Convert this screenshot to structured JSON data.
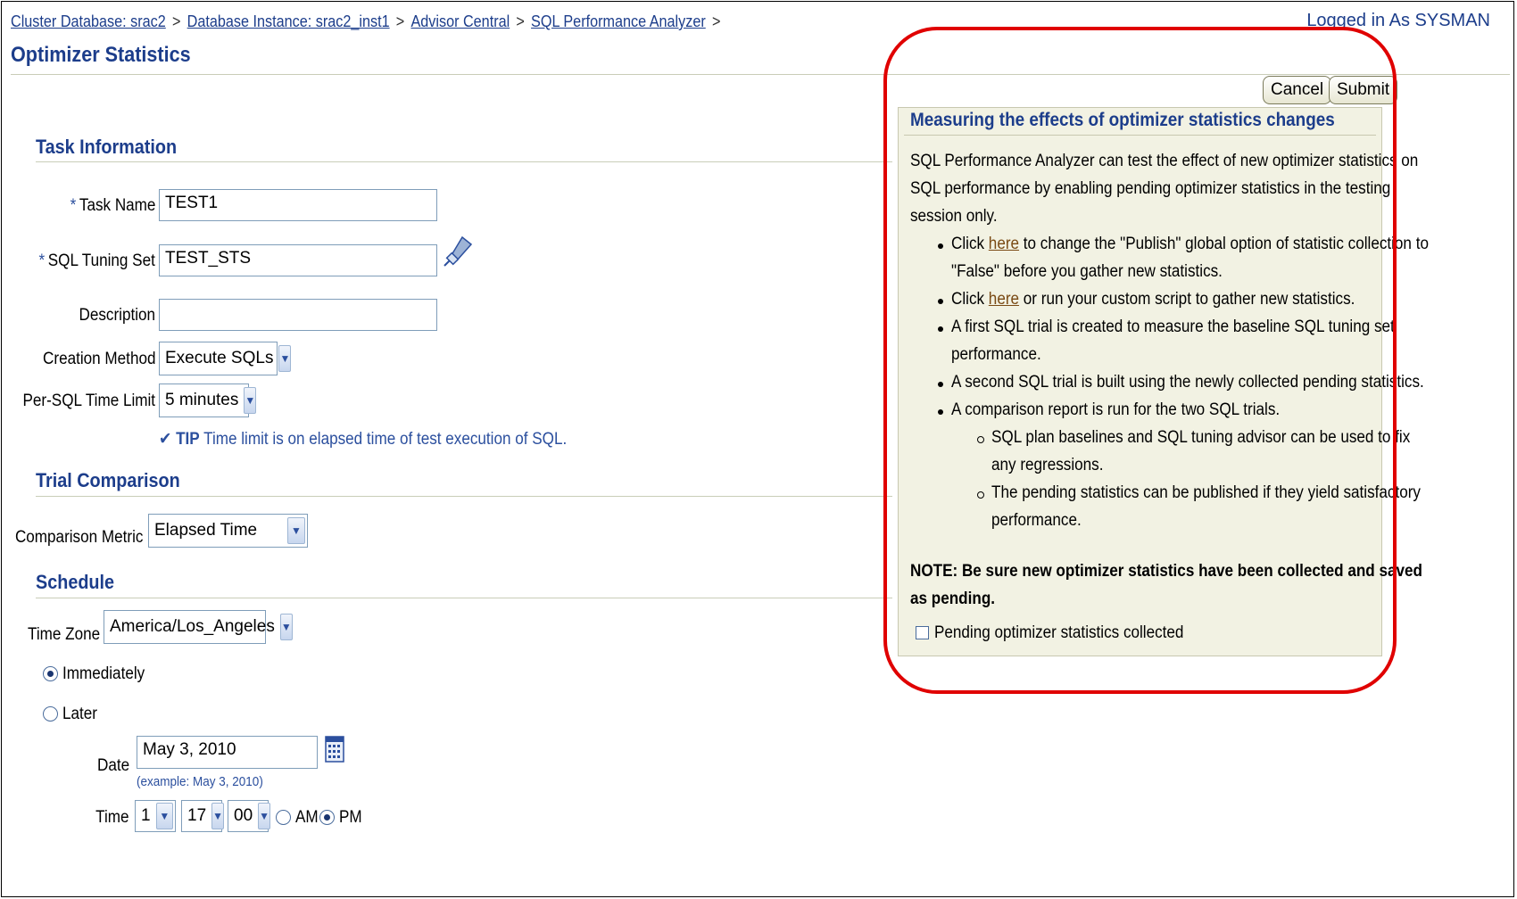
{
  "breadcrumb": [
    "Cluster Database: srac2",
    "Database Instance: srac2_inst1",
    "Advisor Central",
    "SQL Performance Analyzer"
  ],
  "breadcrumb_sep": ">",
  "login_text": "Logged in As SYSMAN",
  "page_title": "Optimizer Statistics",
  "buttons": {
    "cancel": "Cancel",
    "submit": "Submit"
  },
  "task_info": {
    "heading": "Task Information",
    "required_mark": "*",
    "task_name_label": "Task Name",
    "task_name_value": "TEST1",
    "sts_label": "SQL Tuning Set",
    "sts_value": "TEST_STS",
    "description_label": "Description",
    "description_value": "",
    "creation_method_label": "Creation Method",
    "creation_method_value": "Execute SQLs",
    "time_limit_label": "Per-SQL Time Limit",
    "time_limit_value": "5 minutes",
    "tip_label": "TIP",
    "tip_text": "Time limit is on elapsed time of test execution of SQL."
  },
  "trial": {
    "heading": "Trial Comparison",
    "metric_label": "Comparison Metric",
    "metric_value": "Elapsed Time"
  },
  "schedule": {
    "heading": "Schedule",
    "tz_label": "Time Zone",
    "tz_value": "America/Los_Angeles",
    "immediately": "Immediately",
    "later": "Later",
    "date_label": "Date",
    "date_value": "May 3, 2010",
    "date_example": "(example: May 3, 2010)",
    "time_label": "Time",
    "hour": "1",
    "minute": "17",
    "second": "00",
    "am": "AM",
    "pm": "PM"
  },
  "panel": {
    "title": "Measuring the effects of optimizer statistics changes",
    "intro": [
      "SQL Performance Analyzer can test the effect of new optimizer statistics on",
      "SQL performance by enabling pending optimizer statistics in the testing",
      "session only."
    ],
    "b1_pre": "Click",
    "b1_link": "here",
    "b1_post": "to change the \"Publish\" global option of statistic collection to",
    "b1_line2": "\"False\" before you gather new statistics.",
    "b2_pre": "Click",
    "b2_link": "here",
    "b2_post": "or run your custom script to gather new statistics.",
    "b3_line1": "A first SQL trial is created to measure the baseline SQL tuning set",
    "b3_line2": "performance.",
    "b4": "A second SQL trial is built using the newly collected pending statistics.",
    "b5": "A comparison report is run for the two SQL trials.",
    "s1_line1": "SQL plan baselines and SQL tuning advisor can be used to fix",
    "s1_line2": "any regressions.",
    "s2_line1": "The pending statistics can be published if they yield satisfactory",
    "s2_line2": "performance.",
    "note_line1": "NOTE: Be sure new optimizer statistics have been collected and saved",
    "note_line2": "as pending.",
    "checkbox_label": "Pending optimizer statistics collected"
  },
  "colors": {
    "accent": "#1c3d8b",
    "panel_bg": "#f2f2e3",
    "highlight_ring": "#e00000"
  }
}
